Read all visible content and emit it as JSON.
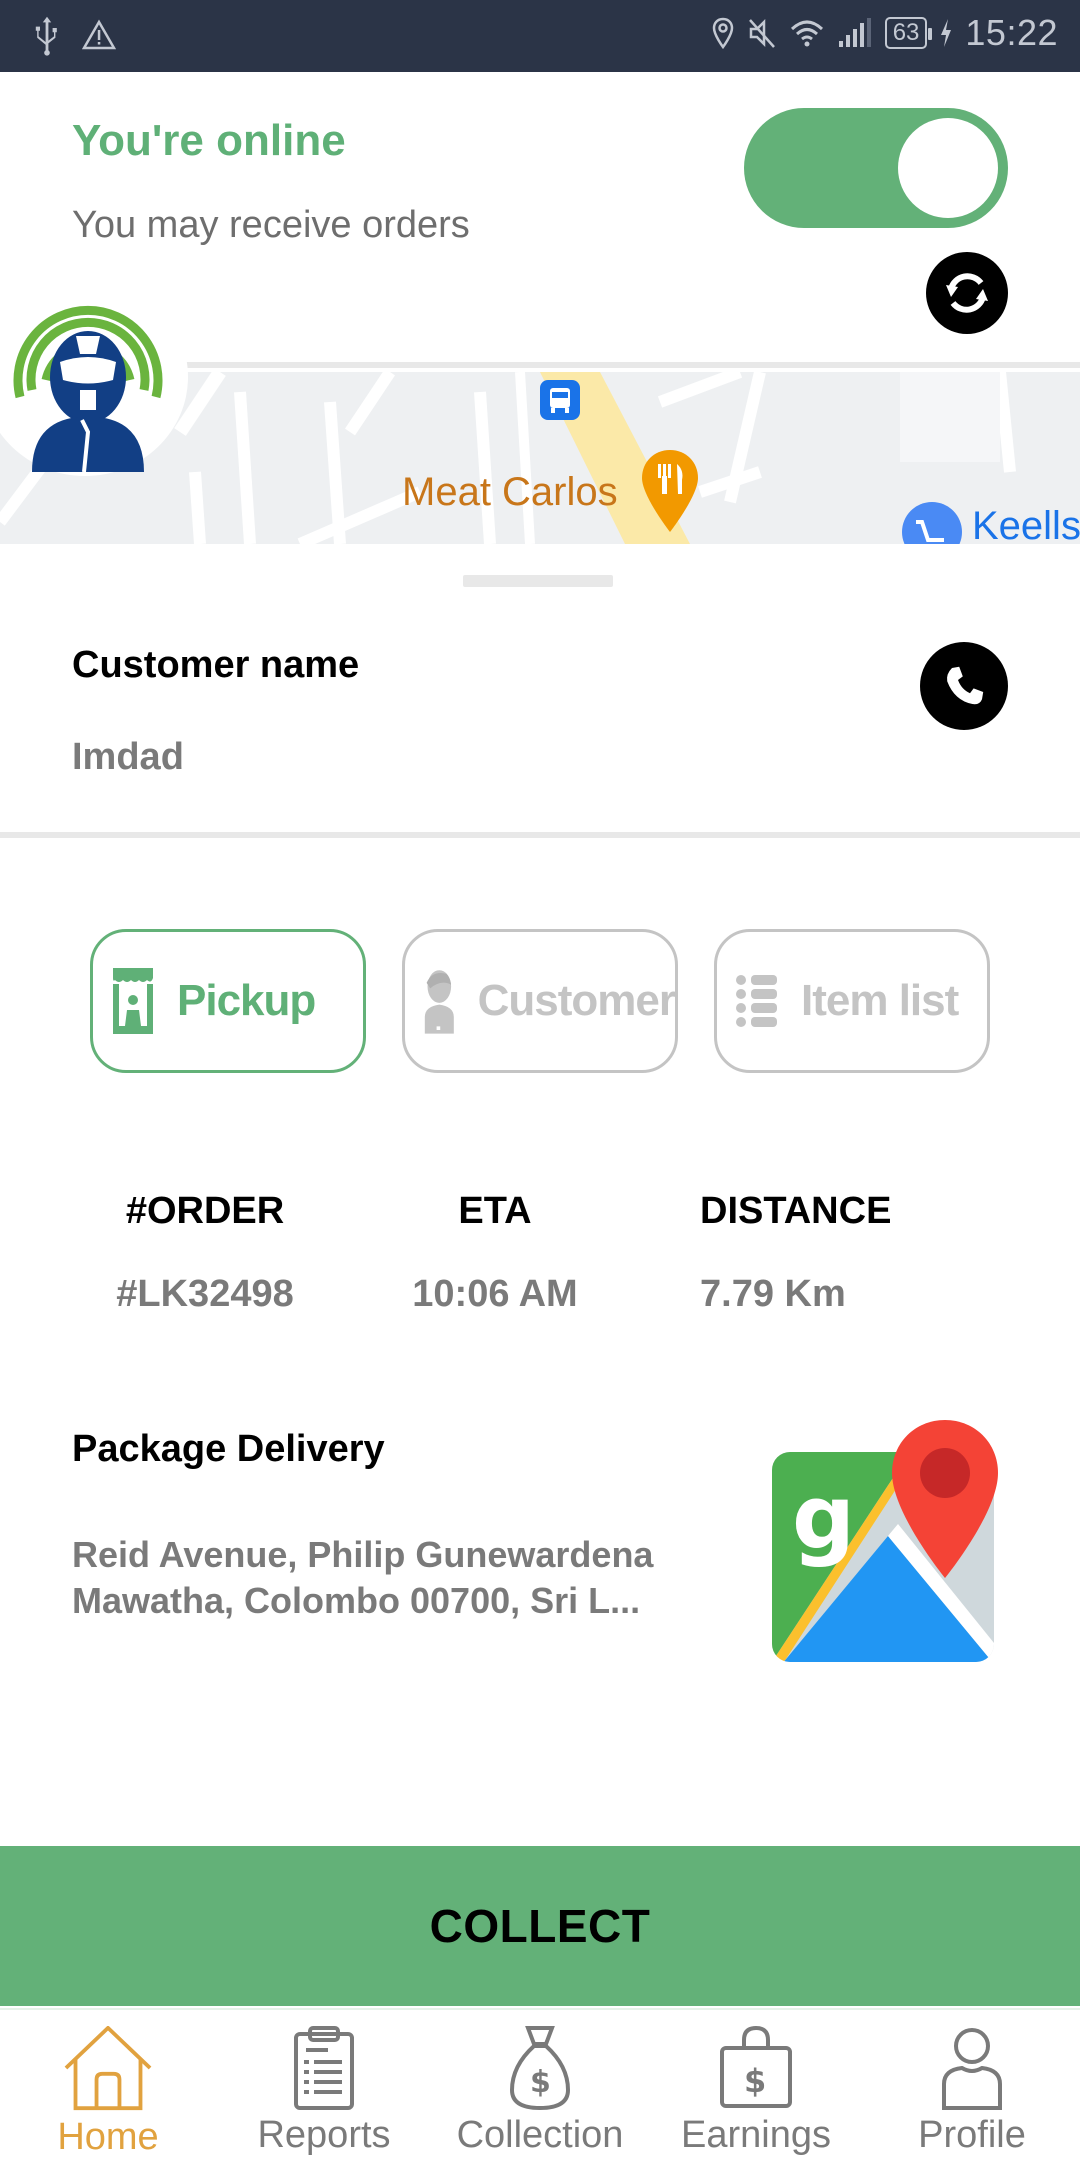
{
  "status_bar": {
    "left_icons": [
      "usb-icon",
      "warning-icon"
    ],
    "right_icons": [
      "location-icon",
      "mute-icon",
      "wifi-icon",
      "signal-icon"
    ],
    "battery": "63",
    "time": "15:22"
  },
  "header": {
    "title": "You're online",
    "subtitle": "You may receive orders",
    "online_toggle": true,
    "refresh_icon": "refresh-icon"
  },
  "map": {
    "poi_label": "Meat Carlos",
    "store_label": "Keells",
    "icons": [
      "bus-stop-icon",
      "restaurant-pin-icon",
      "shopping-cart-pin-icon",
      "driver-avatar-icon"
    ]
  },
  "customer": {
    "label": "Customer name",
    "name": "Imdad",
    "call_icon": "phone-icon"
  },
  "tabs": [
    {
      "label": "Pickup",
      "icon": "store-icon",
      "active": true
    },
    {
      "label": "Customer",
      "icon": "person-icon",
      "active": false
    },
    {
      "label": "Item list",
      "icon": "list-icon",
      "active": false
    }
  ],
  "order_info": {
    "order": {
      "header": "#ORDER",
      "value": "#LK32498"
    },
    "eta": {
      "header": "ETA",
      "value": "10:06 AM"
    },
    "distance": {
      "header": "DISTANCE",
      "value": "7.79 Km"
    }
  },
  "package": {
    "title": "Package Delivery",
    "address": "Reid Avenue, Philip Gunewardena Mawatha, Colombo 00700, Sri L...",
    "maps_icon": "google-maps-icon"
  },
  "actions": {
    "collect_label": "COLLECT"
  },
  "bottom_nav": [
    {
      "label": "Home",
      "icon": "home-icon",
      "active": true
    },
    {
      "label": "Reports",
      "icon": "clipboard-icon",
      "active": false
    },
    {
      "label": "Collection",
      "icon": "money-bag-icon",
      "active": false
    },
    {
      "label": "Earnings",
      "icon": "money-bag-lock-icon",
      "active": false
    },
    {
      "label": "Profile",
      "icon": "user-icon",
      "active": false
    }
  ],
  "colors": {
    "primary_green": "#63b178",
    "accent_orange": "#e1a23f",
    "status_bar_bg": "#2b3447",
    "muted_text": "#7a7a7a"
  }
}
